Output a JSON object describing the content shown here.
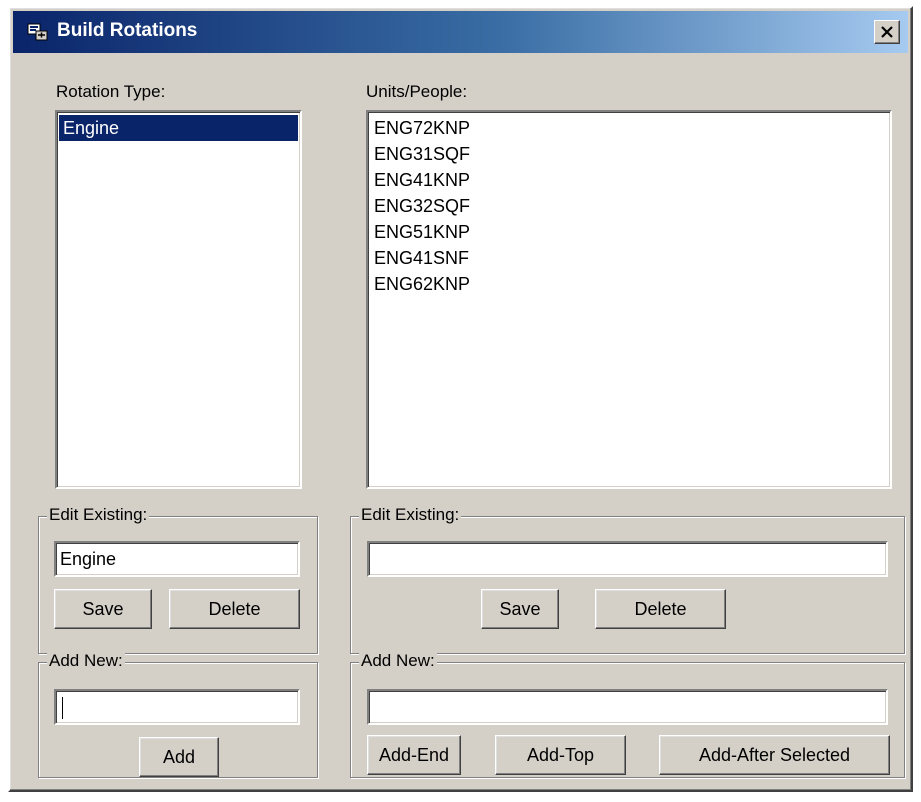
{
  "window": {
    "title": "Build Rotations"
  },
  "left": {
    "list_label": "Rotation Type:",
    "items": [
      "Engine"
    ],
    "selected_index": 0,
    "edit": {
      "legend": "Edit Existing:",
      "value": "Engine",
      "save_label": "Save",
      "delete_label": "Delete"
    },
    "add": {
      "legend": "Add New:",
      "value": "",
      "add_label": "Add"
    }
  },
  "right": {
    "list_label": "Units/People:",
    "items": [
      "ENG72KNP",
      "ENG31SQF",
      "ENG41KNP",
      "ENG32SQF",
      "ENG51KNP",
      "ENG41SNF",
      "ENG62KNP"
    ],
    "edit": {
      "legend": "Edit Existing:",
      "value": "",
      "save_label": "Save",
      "delete_label": "Delete"
    },
    "add": {
      "legend": "Add New:",
      "value": "",
      "add_end_label": "Add-End",
      "add_top_label": "Add-Top",
      "add_after_label": "Add-After Selected"
    }
  },
  "colors": {
    "selection": "#0a246a",
    "title_start": "#0a246a",
    "title_end": "#a6caf0",
    "face": "#d4d0c8"
  }
}
